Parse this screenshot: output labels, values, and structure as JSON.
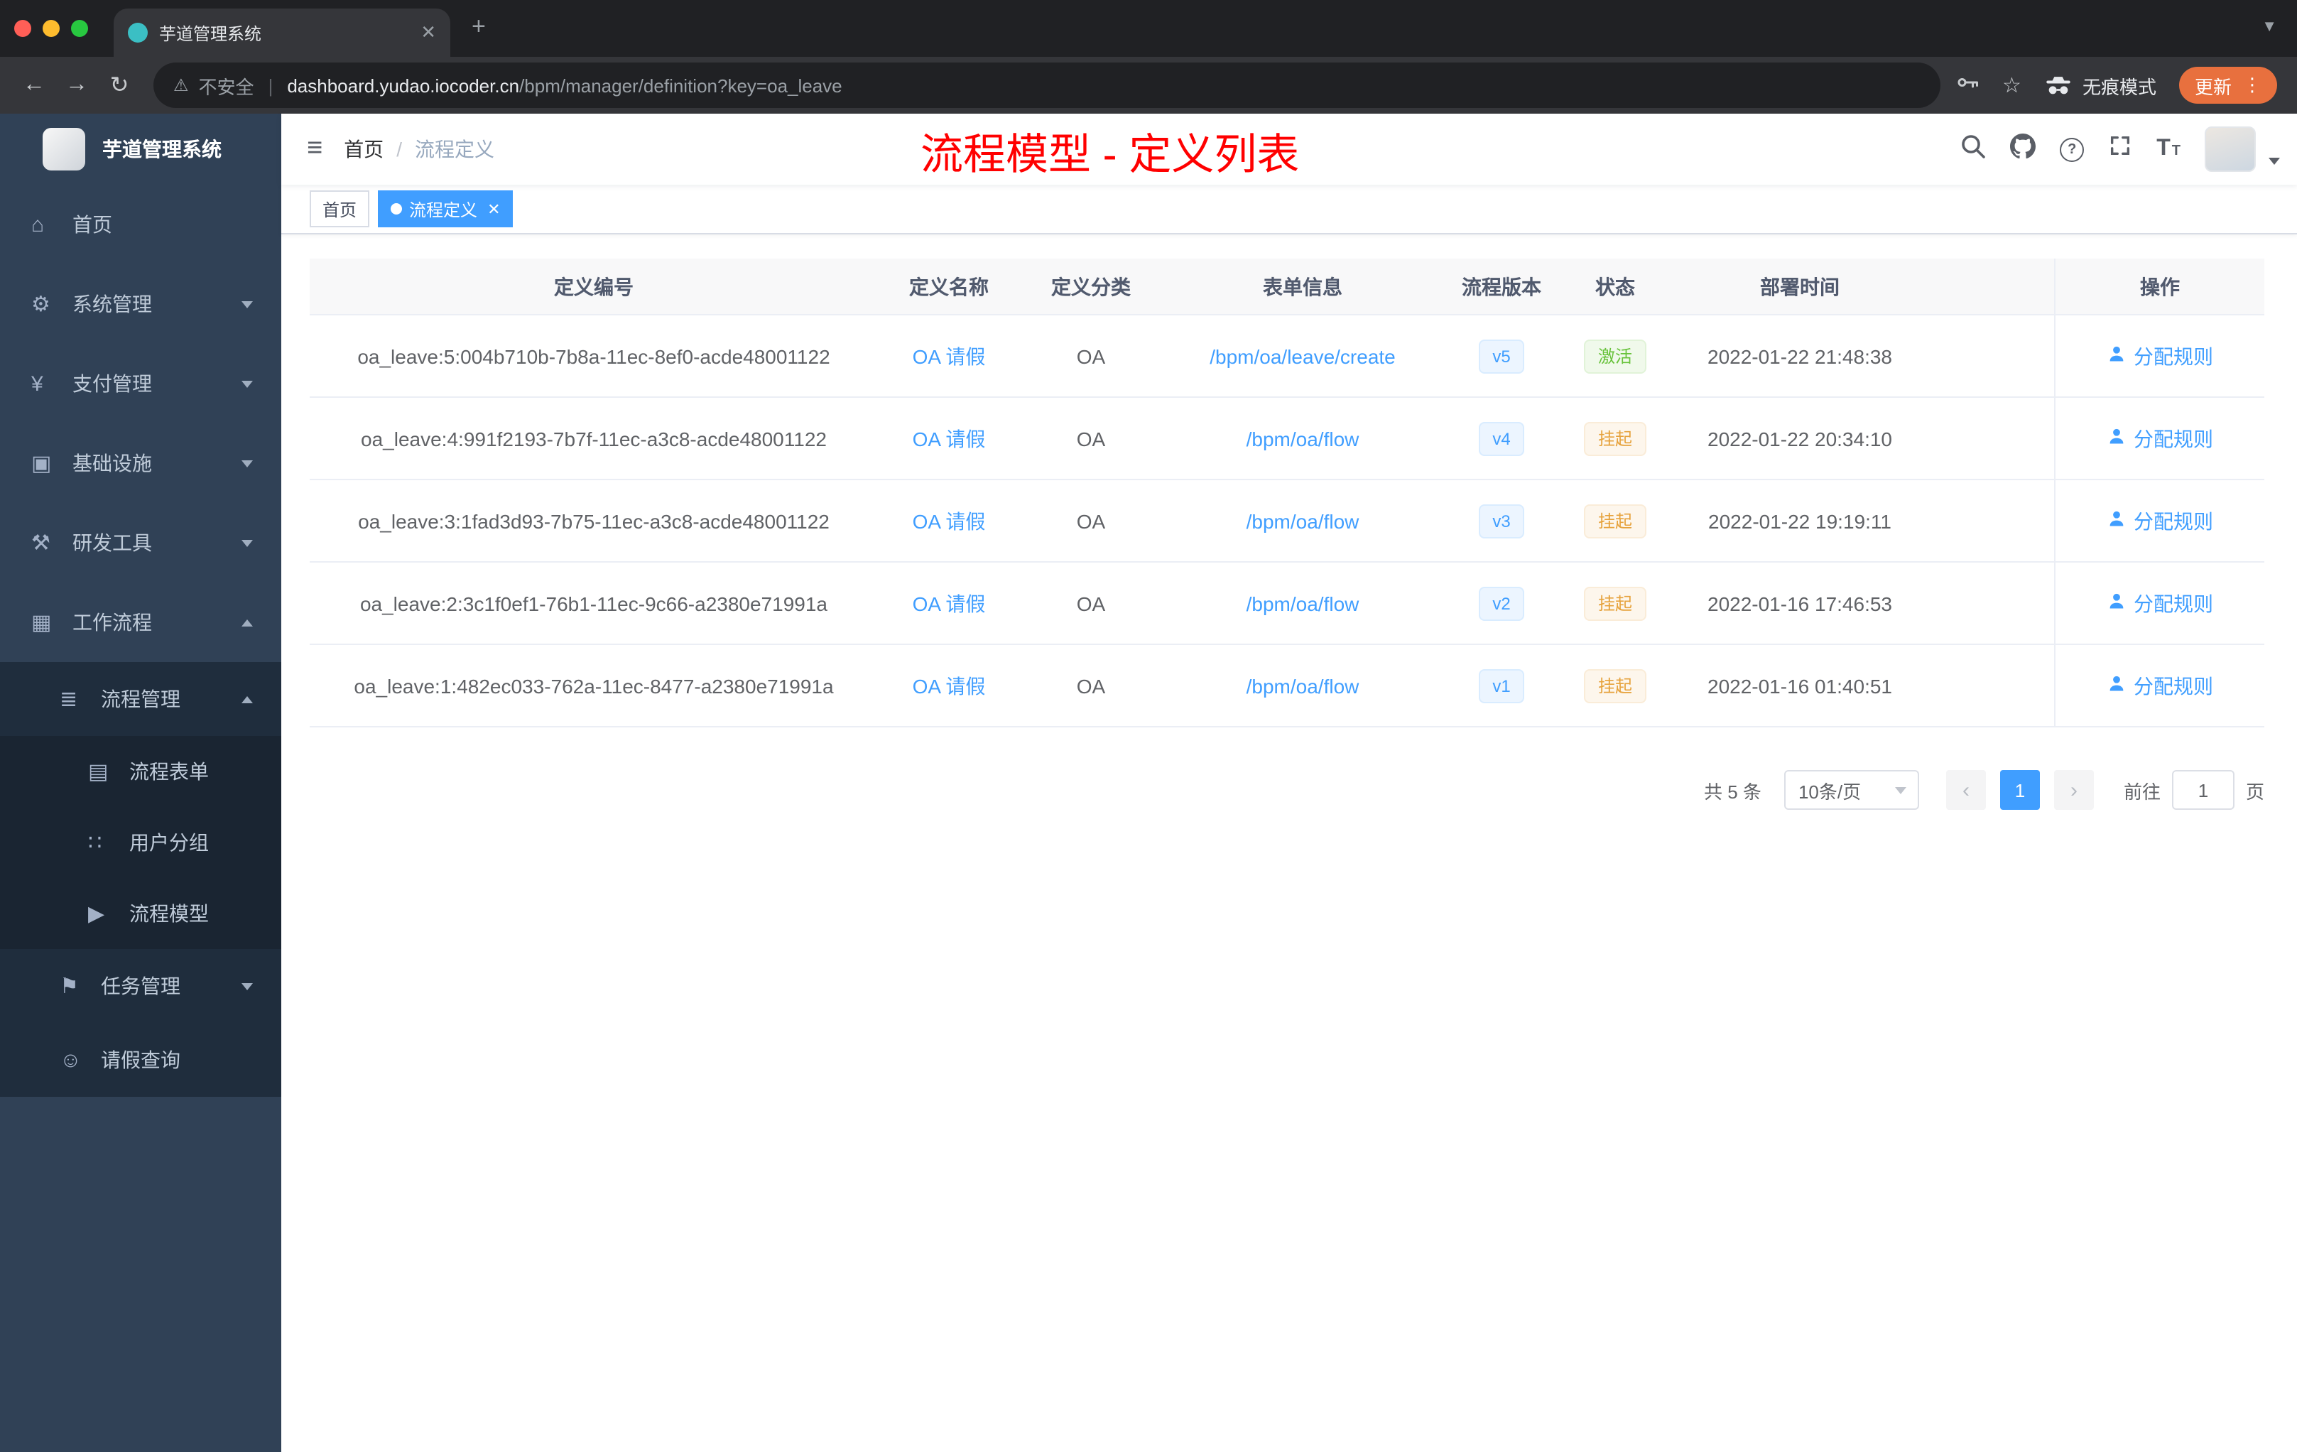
{
  "browser": {
    "tab_title": "芋道管理系统",
    "security_label": "不安全",
    "url_domain": "dashboard.yudao.iocoder.cn",
    "url_path": "/bpm/manager/definition?key=oa_leave",
    "incognito_label": "无痕模式",
    "update_label": "更新"
  },
  "sidebar": {
    "title": "芋道管理系统",
    "items": [
      {
        "key": "home",
        "label": "首页",
        "icon": "dashboard-icon",
        "level": 1
      },
      {
        "key": "system",
        "label": "系统管理",
        "icon": "gear-icon",
        "level": 1,
        "chevron": "down"
      },
      {
        "key": "payment",
        "label": "支付管理",
        "icon": "yen-icon",
        "level": 1,
        "chevron": "down"
      },
      {
        "key": "infra",
        "label": "基础设施",
        "icon": "infra-icon",
        "level": 1,
        "chevron": "down"
      },
      {
        "key": "devtools",
        "label": "研发工具",
        "icon": "tools-icon",
        "level": 1,
        "chevron": "down"
      },
      {
        "key": "workflow",
        "label": "工作流程",
        "icon": "workflow-icon",
        "level": 1,
        "chevron": "up"
      },
      {
        "key": "process-manage",
        "label": "流程管理",
        "icon": "process-list-icon",
        "level": 2,
        "chevron": "up"
      },
      {
        "key": "process-form",
        "label": "流程表单",
        "icon": "form-icon",
        "level": 3
      },
      {
        "key": "user-group",
        "label": "用户分组",
        "icon": "user-group-icon",
        "level": 3
      },
      {
        "key": "process-model",
        "label": "流程模型",
        "icon": "send-icon",
        "level": 3
      },
      {
        "key": "task-manage",
        "label": "任务管理",
        "icon": "flag-icon",
        "level": 2,
        "chevron": "down"
      },
      {
        "key": "leave-query",
        "label": "请假查询",
        "icon": "person-icon",
        "level": 2
      }
    ]
  },
  "header": {
    "breadcrumb_home": "首页",
    "breadcrumb_separator": "/",
    "breadcrumb_current": "流程定义",
    "annotation": "流程模型 - 定义列表"
  },
  "tags": [
    {
      "label": "首页",
      "active": false
    },
    {
      "label": "流程定义",
      "active": true
    }
  ],
  "table": {
    "columns": [
      "定义编号",
      "定义名称",
      "定义分类",
      "表单信息",
      "流程版本",
      "状态",
      "部署时间",
      "操作"
    ],
    "rows": [
      {
        "id": "oa_leave:5:004b710b-7b8a-11ec-8ef0-acde48001122",
        "name": "OA 请假",
        "category": "OA",
        "form": "/bpm/oa/leave/create",
        "version": "v5",
        "status": "激活",
        "status_type": "success",
        "time": "2022-01-22 21:48:38",
        "action": "分配规则"
      },
      {
        "id": "oa_leave:4:991f2193-7b7f-11ec-a3c8-acde48001122",
        "name": "OA 请假",
        "category": "OA",
        "form": "/bpm/oa/flow",
        "version": "v4",
        "status": "挂起",
        "status_type": "warning",
        "time": "2022-01-22 20:34:10",
        "action": "分配规则"
      },
      {
        "id": "oa_leave:3:1fad3d93-7b75-11ec-a3c8-acde48001122",
        "name": "OA 请假",
        "category": "OA",
        "form": "/bpm/oa/flow",
        "version": "v3",
        "status": "挂起",
        "status_type": "warning",
        "time": "2022-01-22 19:19:11",
        "action": "分配规则"
      },
      {
        "id": "oa_leave:2:3c1f0ef1-76b1-11ec-9c66-a2380e71991a",
        "name": "OA 请假",
        "category": "OA",
        "form": "/bpm/oa/flow",
        "version": "v2",
        "status": "挂起",
        "status_type": "warning",
        "time": "2022-01-16 17:46:53",
        "action": "分配规则"
      },
      {
        "id": "oa_leave:1:482ec033-762a-11ec-8477-a2380e71991a",
        "name": "OA 请假",
        "category": "OA",
        "form": "/bpm/oa/flow",
        "version": "v1",
        "status": "挂起",
        "status_type": "warning",
        "time": "2022-01-16 01:40:51",
        "action": "分配规则"
      }
    ]
  },
  "pagination": {
    "total": "共 5 条",
    "page_size": "10条/页",
    "current_page": "1",
    "goto_label": "前往",
    "goto_value": "1",
    "unit": "页"
  },
  "colors": {
    "accent": "#409eff",
    "annotation": "#ff0000",
    "success": "#67c23a",
    "warning": "#e6a23c",
    "sidebar_bg": "#304156"
  }
}
